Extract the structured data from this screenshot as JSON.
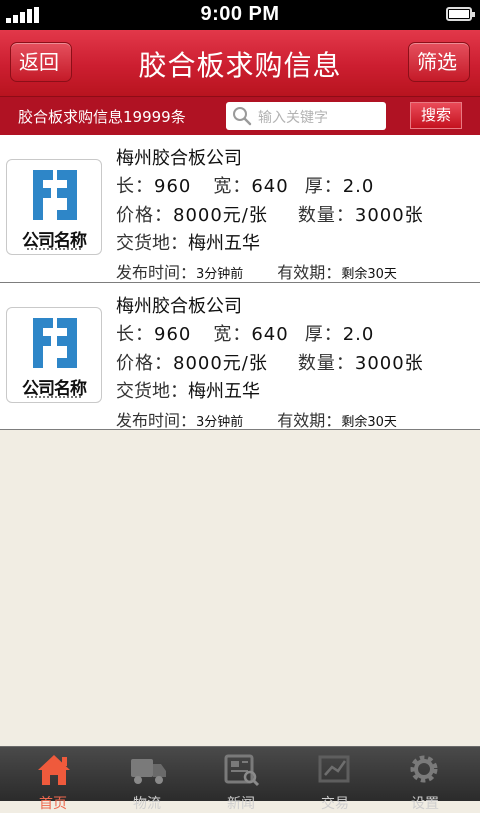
{
  "status_bar": {
    "time": "9:00 PM"
  },
  "header": {
    "back_label": "返回",
    "title": "胶合板求购信息",
    "filter_label": "筛选"
  },
  "search": {
    "count_text": "胶合板求购信息19999条",
    "placeholder": "输入关键字",
    "button_label": "搜索"
  },
  "listings": [
    {
      "logo_text": "公司名称",
      "company": "梅州胶合板公司",
      "length_label": "长：",
      "length": "960",
      "width_label": "宽：",
      "width": "640",
      "thickness_label": "厚：",
      "thickness": "2.0",
      "price_label": "价格：",
      "price": "8000元/张",
      "quantity_label": "数量：",
      "quantity": "3000张",
      "delivery_label": "交货地：",
      "delivery": "梅州五华",
      "published_label": "发布时间：",
      "published": "3分钟前",
      "validity_label": "有效期：",
      "validity": "剩余30天"
    },
    {
      "logo_text": "公司名称",
      "company": "梅州胶合板公司",
      "length_label": "长：",
      "length": "960",
      "width_label": "宽：",
      "width": "640",
      "thickness_label": "厚：",
      "thickness": "2.0",
      "price_label": "价格：",
      "price": "8000元/张",
      "quantity_label": "数量：",
      "quantity": "3000张",
      "delivery_label": "交货地：",
      "delivery": "梅州五华",
      "published_label": "发布时间：",
      "published": "3分钟前",
      "validity_label": "有效期：",
      "validity": "剩余30天"
    }
  ],
  "tabs": [
    {
      "label": "首页",
      "icon": "home-icon",
      "active": true
    },
    {
      "label": "物流",
      "icon": "truck-icon",
      "active": false
    },
    {
      "label": "新闻",
      "icon": "newspaper-icon",
      "active": false
    },
    {
      "label": "交易",
      "icon": "chart-icon",
      "active": false
    },
    {
      "label": "设置",
      "icon": "gear-icon",
      "active": false
    }
  ],
  "colors": {
    "header_red": "#cc1e30",
    "searchbar_red": "#b01223",
    "active_tab": "#f0694f",
    "logo_blue": "#2e86c8"
  }
}
